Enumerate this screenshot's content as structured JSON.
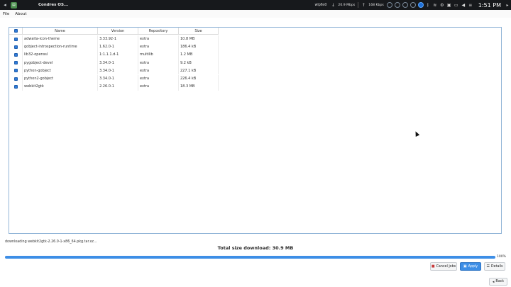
{
  "topbar": {
    "window_title": "Condres OS...",
    "network_name": "wlp6s0",
    "download_rate": "20.9 Mbps",
    "upload_rate": "168 Kbps",
    "clock": "1:51 PM"
  },
  "menubar": {
    "items": [
      "File",
      "About"
    ]
  },
  "table": {
    "columns": [
      "Name",
      "Version",
      "Repository",
      "Size"
    ],
    "rows": [
      {
        "name": "adwaita-icon-theme",
        "version": "3.33.92-1",
        "repository": "extra",
        "size": "10.8 MB"
      },
      {
        "name": "gobject-introspection-runtime",
        "version": "1.62.0-1",
        "repository": "extra",
        "size": "186.4 kB"
      },
      {
        "name": "lib32-openssl",
        "version": "1:1.1.1.d-1",
        "repository": "multilib",
        "size": "1.2 MB"
      },
      {
        "name": "pygobject-devel",
        "version": "3.34.0-1",
        "repository": "extra",
        "size": "9.2 kB"
      },
      {
        "name": "python-gobject",
        "version": "3.34.0-1",
        "repository": "extra",
        "size": "227.1 kB"
      },
      {
        "name": "python2-gobject",
        "version": "3.34.0-1",
        "repository": "extra",
        "size": "226.4 kB"
      },
      {
        "name": "webkit2gtk",
        "version": "2.26.0-1",
        "repository": "extra",
        "size": "18.3 MB"
      }
    ]
  },
  "status": {
    "message": "downloading webkit2gtk-2.26.0-1-x86_64.pkg.tar.xz...",
    "total": "Total size download: 30.9 MB",
    "progress_label": "100%",
    "progress_fraction": 1.0
  },
  "buttons": {
    "cancel": "Cancel jobs",
    "apply": "Apply",
    "details": "Details",
    "back": "Back"
  },
  "colors": {
    "accent": "#3d8ee6",
    "topbar": "#17191c"
  }
}
